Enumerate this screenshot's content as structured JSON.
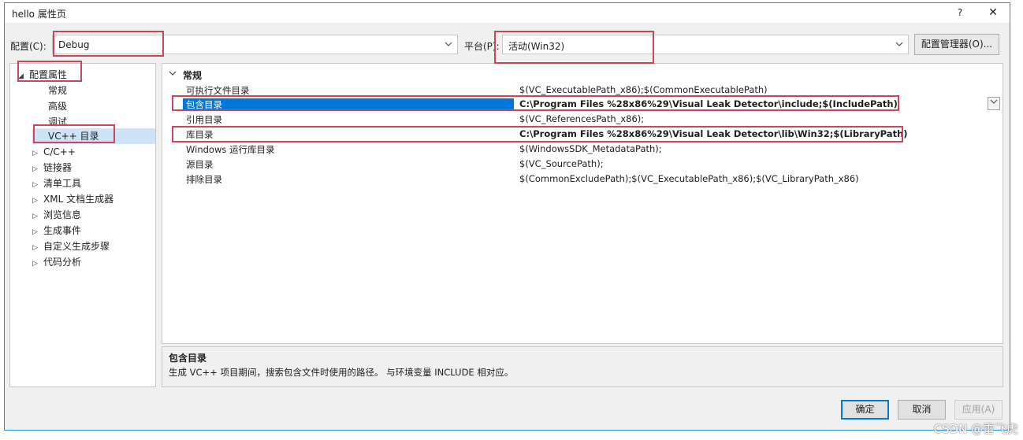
{
  "window": {
    "title": "hello 属性页",
    "help_label": "?",
    "close_label": "✕"
  },
  "config": {
    "label": "配置(C):",
    "value": "Debug",
    "dropdown_icon": "chevron-down-icon"
  },
  "platform": {
    "label": "平台(P):",
    "value": "活动(Win32)"
  },
  "manager_button": "配置管理器(O)...",
  "tree": {
    "root_label": "配置属性",
    "children": [
      "常规",
      "高级",
      "调试",
      "VC++ 目录"
    ],
    "groups": [
      "C/C++",
      "链接器",
      "清单工具",
      "XML 文档生成器",
      "浏览信息",
      "生成事件",
      "自定义生成步骤",
      "代码分析"
    ],
    "selected": "VC++ 目录"
  },
  "grid": {
    "section": "常规",
    "rows": [
      {
        "name": "可执行文件目录",
        "value": "$(VC_ExecutablePath_x86);$(CommonExecutablePath)"
      },
      {
        "name": "包含目录",
        "value": "C:\\Program Files %28x86%29\\Visual Leak Detector\\include;$(IncludePath)"
      },
      {
        "name": "引用目录",
        "value": "$(VC_ReferencesPath_x86);"
      },
      {
        "name": "库目录",
        "value": "C:\\Program Files %28x86%29\\Visual Leak Detector\\lib\\Win32;$(LibraryPath)"
      },
      {
        "name": "Windows 运行库目录",
        "value": "$(WindowsSDK_MetadataPath);"
      },
      {
        "name": "源目录",
        "value": "$(VC_SourcePath);"
      },
      {
        "name": "排除目录",
        "value": "$(CommonExcludePath);$(VC_ExecutablePath_x86);$(VC_LibraryPath_x86)"
      }
    ]
  },
  "description": {
    "title": "包含目录",
    "text": "生成 VC++ 项目期间，搜索包含文件时使用的路径。 与环境变量 INCLUDE 相对应。"
  },
  "buttons": {
    "ok": "确定",
    "cancel": "取消",
    "apply": "应用(A)"
  },
  "watermark": "CSDN @雷飞虎",
  "colors": {
    "accent": "#0078d7",
    "highlight_box": "#c7485b",
    "tree_selection": "#cde3f7"
  }
}
